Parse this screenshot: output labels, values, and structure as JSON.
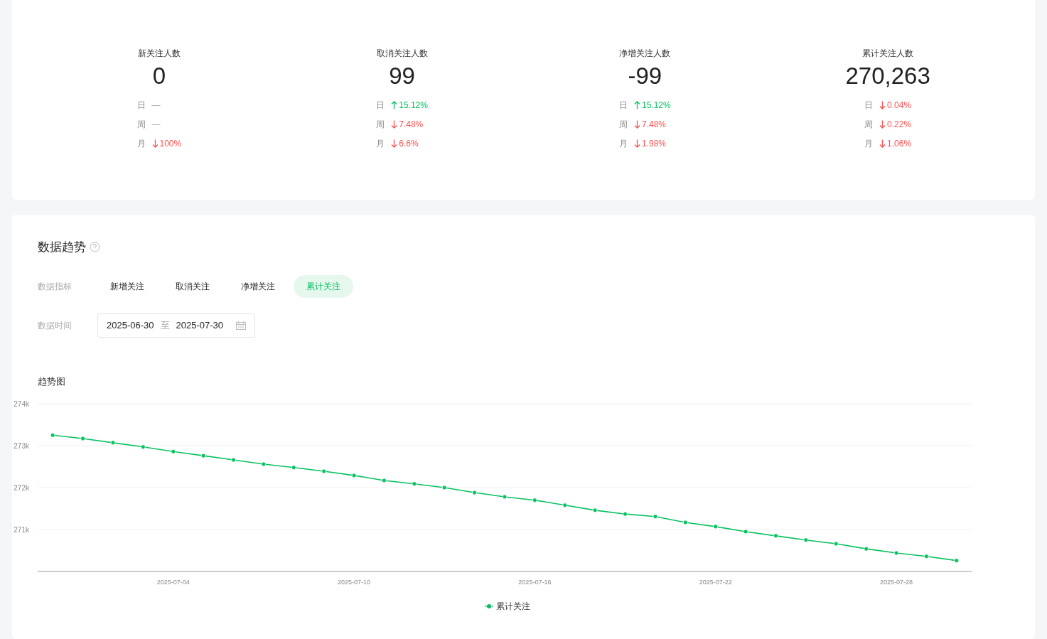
{
  "stats": [
    {
      "label": "新关注人数",
      "value": "0",
      "changes": [
        {
          "period": "日",
          "kind": "none",
          "text": "—"
        },
        {
          "period": "周",
          "kind": "none",
          "text": "—"
        },
        {
          "period": "月",
          "kind": "down",
          "text": "100%"
        }
      ]
    },
    {
      "label": "取消关注人数",
      "value": "99",
      "changes": [
        {
          "period": "日",
          "kind": "up",
          "text": "15.12%"
        },
        {
          "period": "周",
          "kind": "down",
          "text": "7.48%"
        },
        {
          "period": "月",
          "kind": "down",
          "text": "6.6%"
        }
      ]
    },
    {
      "label": "净增关注人数",
      "value": "-99",
      "changes": [
        {
          "period": "日",
          "kind": "up",
          "text": "15.12%"
        },
        {
          "period": "周",
          "kind": "down",
          "text": "7.48%"
        },
        {
          "period": "月",
          "kind": "down",
          "text": "1.98%"
        }
      ]
    },
    {
      "label": "累计关注人数",
      "value": "270,263",
      "changes": [
        {
          "period": "日",
          "kind": "down",
          "text": "0.04%"
        },
        {
          "period": "周",
          "kind": "down",
          "text": "0.22%"
        },
        {
          "period": "月",
          "kind": "down",
          "text": "1.06%"
        }
      ]
    }
  ],
  "trend": {
    "title": "数据趋势",
    "metric_label": "数据指标",
    "metrics": [
      {
        "label": "新增关注",
        "selected": false
      },
      {
        "label": "取消关注",
        "selected": false
      },
      {
        "label": "净增关注",
        "selected": false
      },
      {
        "label": "累计关注",
        "selected": true
      }
    ],
    "time_label": "数据时间",
    "date_range": {
      "start": "2025-06-30",
      "separator": "至",
      "end": "2025-07-30"
    },
    "chart_title": "趋势图",
    "chart_data": {
      "type": "line",
      "grid": true,
      "categories": [
        null,
        null,
        null,
        null,
        "2025-07-04",
        null,
        null,
        null,
        null,
        null,
        "2025-07-10",
        null,
        null,
        null,
        null,
        null,
        "2025-07-16",
        null,
        null,
        null,
        null,
        null,
        "2025-07-22",
        null,
        null,
        null,
        null,
        null,
        "2025-07-28",
        null,
        null
      ],
      "series": [
        {
          "name": "累计关注",
          "color": "#07c160",
          "marker": "circle",
          "values": [
            273250,
            273170,
            273070,
            272970,
            272860,
            272760,
            272660,
            272560,
            272480,
            272390,
            272290,
            272170,
            272090,
            272000,
            271880,
            271780,
            271700,
            271580,
            271460,
            271370,
            271310,
            271170,
            271070,
            270950,
            270850,
            270750,
            270660,
            270540,
            270440,
            270360,
            270260
          ]
        }
      ],
      "ylim": [
        270000,
        274000
      ],
      "yticks": [
        {
          "value": 271000,
          "label": "271k"
        },
        {
          "value": 272000,
          "label": "272k"
        },
        {
          "value": 273000,
          "label": "273k"
        },
        {
          "value": 274000,
          "label": "274k"
        }
      ]
    }
  }
}
